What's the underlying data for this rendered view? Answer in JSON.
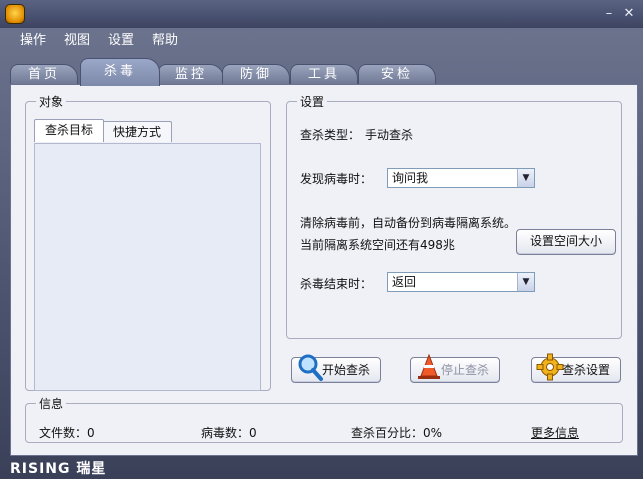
{
  "window": {
    "minimize_label": "–",
    "close_label": "✕"
  },
  "menu": {
    "items": [
      "操作",
      "视图",
      "设置",
      "帮助"
    ]
  },
  "tabs": [
    "首页",
    "杀毒",
    "监控",
    "防御",
    "工具",
    "安检"
  ],
  "active_tab": "杀毒",
  "target_panel": {
    "legend": "对象",
    "subtabs": [
      "查杀目标",
      "快捷方式"
    ]
  },
  "settings_panel": {
    "legend": "设置",
    "scan_type_label": "查杀类型：",
    "scan_type_value": "手动查杀",
    "on_virus_label": "发现病毒时：",
    "on_virus_value": "询问我",
    "backup_note": "清除病毒前，自动备份到病毒隔离系统。",
    "quarantine_note": "当前隔离系统空间还有498兆",
    "quarantine_button": "设置空间大小",
    "on_finish_label": "杀毒结束时：",
    "on_finish_value": "返回"
  },
  "actions": {
    "start_scan": "开始查杀",
    "stop_scan": "停止查杀",
    "scan_settings": "查杀设置"
  },
  "info_panel": {
    "legend": "信息",
    "file_count": "文件数：0",
    "virus_count": "病毒数：0",
    "scan_percent": "查杀百分比：0%",
    "more_info": "更多信息"
  },
  "brand": "RISING 瑞星"
}
